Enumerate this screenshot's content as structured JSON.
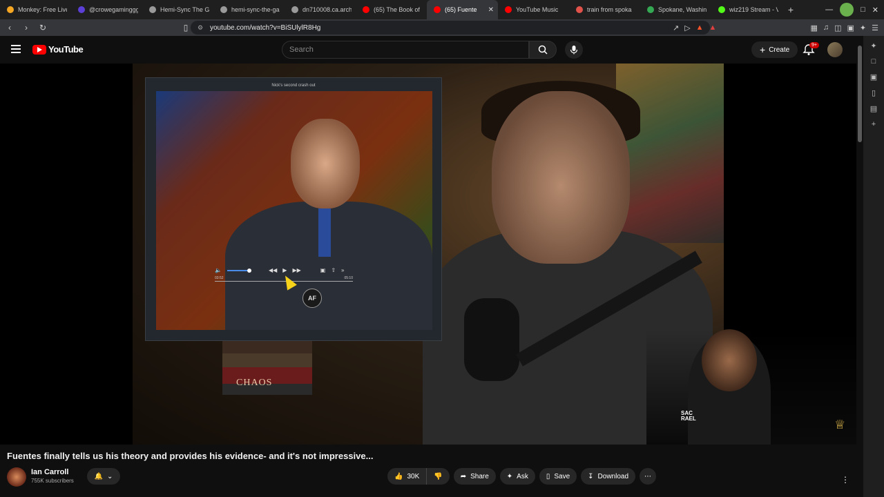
{
  "browser": {
    "tabs": [
      {
        "title": "Monkey: Free Live",
        "color": "#f5a623"
      },
      {
        "title": "@crowegaminggg",
        "color": "#5b3fd6"
      },
      {
        "title": "Hemi-Sync The Ga",
        "color": "#9a9a9a"
      },
      {
        "title": "hemi-sync-the-ga",
        "color": "#9a9a9a"
      },
      {
        "title": "dn710008.ca.arch",
        "color": "#9a9a9a"
      },
      {
        "title": "(65) The Book of",
        "color": "#ff0000"
      },
      {
        "title": "(65) Fuente",
        "color": "#ff0000",
        "active": true
      },
      {
        "title": "YouTube Music",
        "color": "#ff0000"
      },
      {
        "title": "train from spoka",
        "color": "#e0524a"
      },
      {
        "title": "Spokane, Washin",
        "color": "#34a853"
      },
      {
        "title": "wiz219 Stream - V",
        "color": "#53fc18"
      }
    ],
    "new_tab": "+",
    "url": "youtube.com/watch?v=BiSUlylR8Hg"
  },
  "youtube": {
    "logo_text": "YouTube",
    "search_placeholder": "Search",
    "create_label": "Create",
    "notifications_badge": "9+"
  },
  "video": {
    "inset_title": "Nick's second crash out",
    "inset_time_current": "03:52",
    "inset_time_total": "05:10",
    "inset_logo": "AF",
    "books_label": "CHAOS",
    "pip_text_line1": "SAC",
    "pip_text_line2": "RAEL"
  },
  "meta": {
    "title": "Fuentes finally tells us his theory and provides his evidence- and it's not impressive...",
    "channel_name": "Ian Carroll",
    "subscribers": "755K subscribers",
    "likes": "30K",
    "share_label": "Share",
    "ask_label": "Ask",
    "save_label": "Save",
    "download_label": "Download"
  },
  "icons": {
    "accent_red": "#ff0000"
  }
}
